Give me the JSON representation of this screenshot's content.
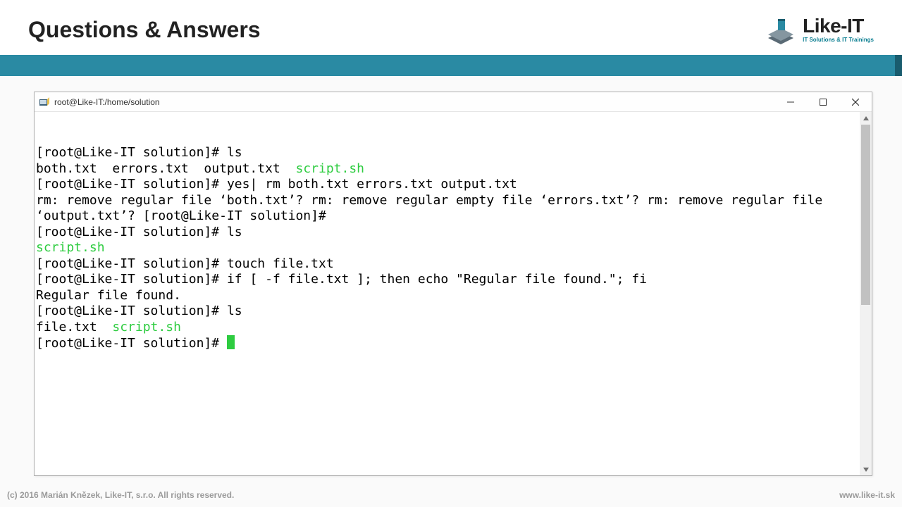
{
  "header": {
    "title": "Questions & Answers"
  },
  "logo": {
    "brand": "Like-IT",
    "tagline": "IT Solutions & IT Trainings"
  },
  "terminal": {
    "title": "root@Like-IT:/home/solution",
    "prompt": "[root@Like-IT solution]# ",
    "lines": {
      "l1_cmd": "ls",
      "l2a": "both.txt  errors.txt  output.txt  ",
      "l2b_green": "script.sh",
      "l3_cmd": "yes| rm both.txt errors.txt output.txt",
      "l4": "rm: remove regular file ‘both.txt’? rm: remove regular empty file ‘errors.txt’? rm: remove regular file ‘output.txt’? [root@Like-IT solution]#",
      "l5_cmd": "ls",
      "l6_green": "script.sh",
      "l7_cmd": "touch file.txt",
      "l8_cmd": "if [ -f file.txt ]; then echo \"Regular file found.\"; fi",
      "l9": "Regular file found.",
      "l10_cmd": "ls",
      "l11a": "file.txt  ",
      "l11b_green": "script.sh"
    }
  },
  "footer": {
    "copyright": "(c) 2016 Marián Knězek, Like-IT, s.r.o. All rights reserved.",
    "url": "www.like-it.sk"
  }
}
